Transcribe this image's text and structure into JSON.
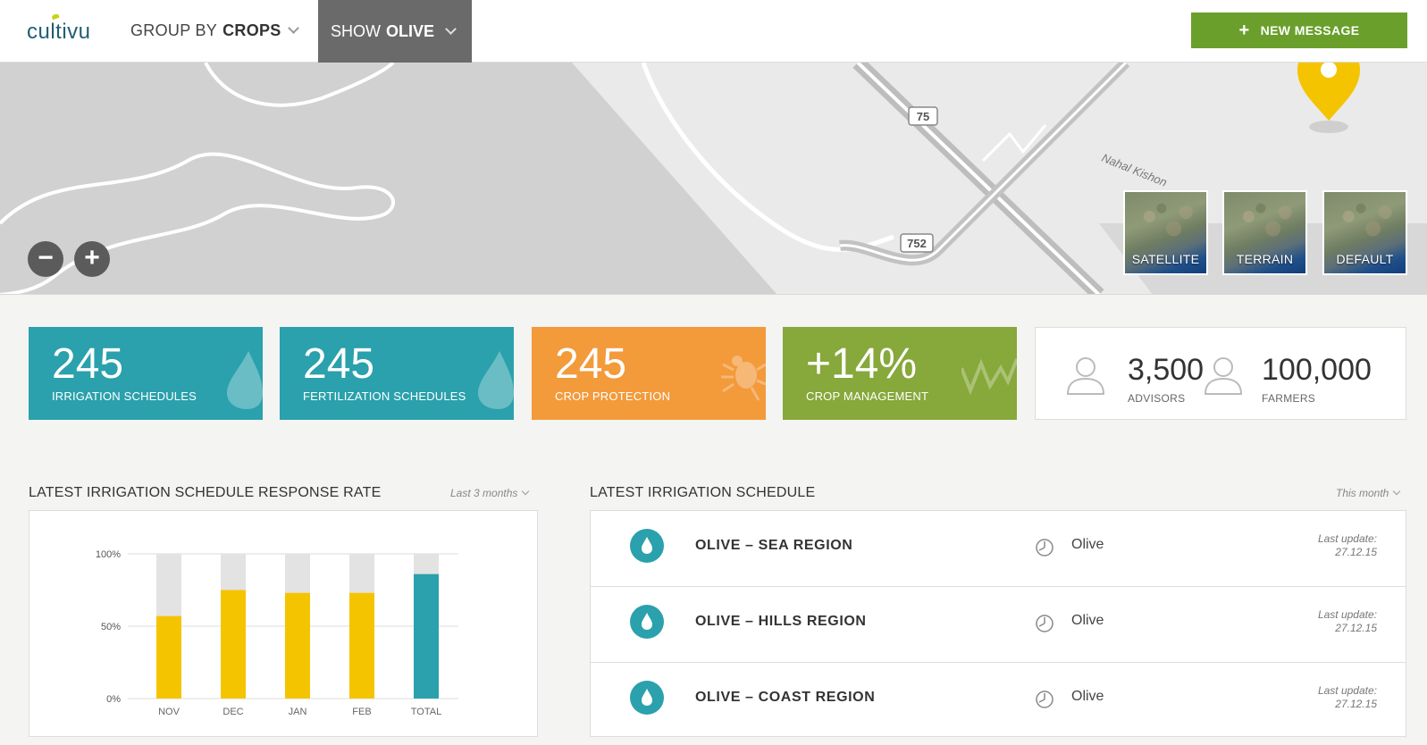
{
  "header": {
    "logo": "cultivu",
    "group_by_prefix": "GROUP BY",
    "group_by_value": "CROPS",
    "show_prefix": "SHOW",
    "show_value": "OLIVE",
    "new_message": "NEW MESSAGE",
    "accent_color": "#6a9f2c"
  },
  "map": {
    "road_labels": [
      "75",
      "752"
    ],
    "place_label": "Nahal Kishon",
    "zoom_out": "−",
    "zoom_in": "+",
    "marker_color": "#f5c400",
    "types": [
      "SATELLITE",
      "TERRAIN",
      "DEFAULT"
    ]
  },
  "stats": [
    {
      "value": "245",
      "label": "IRRIGATION SCHEDULES",
      "color": "#2aa1ac",
      "icon": "water-drop-icon"
    },
    {
      "value": "245",
      "label": "FERTILIZATION SCHEDULES",
      "color": "#2aa1ac",
      "icon": "water-drop-icon"
    },
    {
      "value": "245",
      "label": "CROP PROTECTION",
      "color": "#f39a3b",
      "icon": "bug-icon"
    },
    {
      "value": "+14%",
      "label": "CROP MANAGEMENT",
      "color": "#87a83a",
      "icon": "pulse-icon"
    }
  ],
  "people": {
    "advisors_value": "3,500",
    "advisors_label": "ADVISORS",
    "farmers_value": "100,000",
    "farmers_label": "FARMERS"
  },
  "response_rate": {
    "title": "LATEST IRRIGATION SCHEDULE RESPONSE RATE",
    "filter": "Last 3 months"
  },
  "chart_data": {
    "type": "bar",
    "categories": [
      "NOV",
      "DEC",
      "JAN",
      "FEB",
      "TOTAL"
    ],
    "values": [
      57,
      75,
      73,
      73,
      86
    ],
    "ylim": [
      0,
      100
    ],
    "yticks": [
      "0%",
      "50%",
      "100%"
    ],
    "bar_colors": [
      "#f5c400",
      "#f5c400",
      "#f5c400",
      "#f5c400",
      "#2aa1ac"
    ],
    "background_color": "#e3e3e3",
    "grid": true
  },
  "schedule": {
    "title": "LATEST IRRIGATION SCHEDULE",
    "filter": "This month",
    "rows": [
      {
        "region": "OLIVE – SEA REGION",
        "crop": "Olive",
        "update_label": "Last update:",
        "update_date": "27.12.15"
      },
      {
        "region": "OLIVE – HILLS REGION",
        "crop": "Olive",
        "update_label": "Last update:",
        "update_date": "27.12.15"
      },
      {
        "region": "OLIVE – COAST REGION",
        "crop": "Olive",
        "update_label": "Last update:",
        "update_date": "27.12.15"
      }
    ]
  }
}
